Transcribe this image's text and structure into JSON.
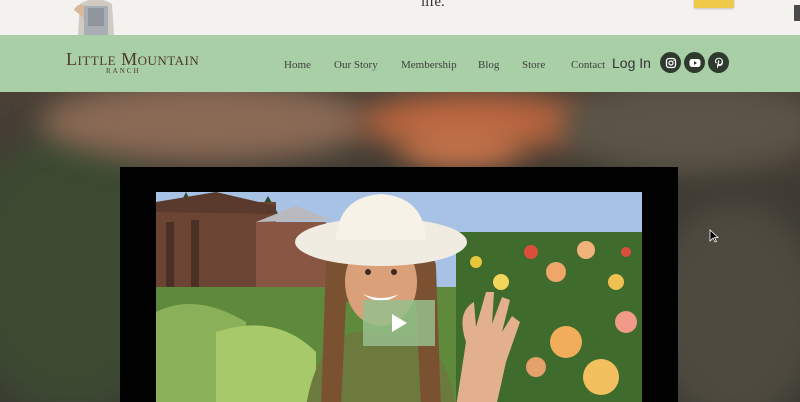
{
  "top": {
    "text": "life."
  },
  "logo": {
    "main": "Little Mountain",
    "sub": "RANCH"
  },
  "nav": {
    "items": [
      {
        "label": "Home",
        "name": "nav-home"
      },
      {
        "label": "Our Story",
        "name": "nav-our-story"
      },
      {
        "label": "Membership",
        "name": "nav-membership"
      },
      {
        "label": "Blog",
        "name": "nav-blog"
      },
      {
        "label": "Store",
        "name": "nav-store"
      },
      {
        "label": "Contact",
        "name": "nav-contact"
      }
    ],
    "login_label": "Log In"
  },
  "social": [
    "instagram-icon",
    "youtube-icon",
    "pinterest-icon"
  ],
  "colors": {
    "header_bg": "#a8cfa6",
    "social_bg": "#2e3a2e",
    "accent_button": "#f1c948",
    "play_button": "#96be8c"
  }
}
